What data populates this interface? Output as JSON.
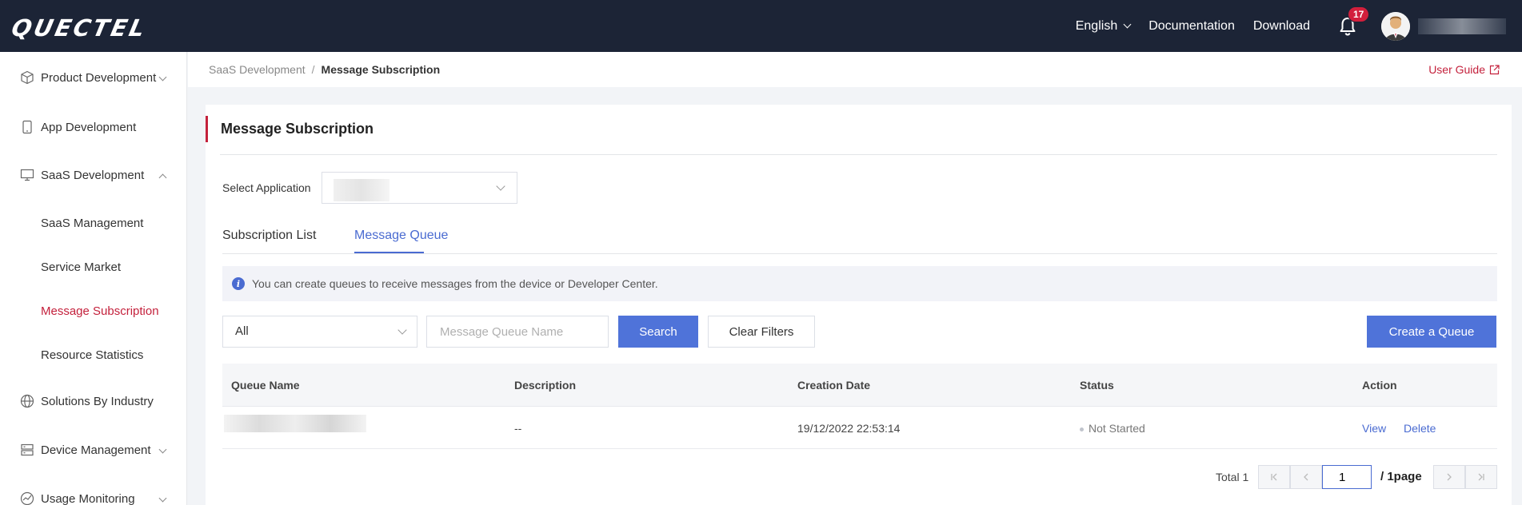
{
  "header": {
    "logo": "QUECTEL",
    "language": "English",
    "documentation": "Documentation",
    "download": "Download",
    "notification_count": "17"
  },
  "sidebar": {
    "items": [
      {
        "label": "Product Development",
        "icon": "cube-icon",
        "expanded": false
      },
      {
        "label": "App Development",
        "icon": "mobile-icon"
      },
      {
        "label": "SaaS Development",
        "icon": "monitor-icon",
        "expanded": true
      },
      {
        "label": "Solutions By Industry",
        "icon": "globe-icon",
        "expanded": false
      },
      {
        "label": "Device Management",
        "icon": "server-icon",
        "expanded": false
      },
      {
        "label": "Usage Monitoring",
        "icon": "gauge-icon",
        "expanded": false
      }
    ],
    "saas_sub": [
      {
        "label": "SaaS Management"
      },
      {
        "label": "Service Market"
      },
      {
        "label": "Message Subscription",
        "active": true
      },
      {
        "label": "Resource Statistics"
      }
    ]
  },
  "breadcrumb": {
    "parent": "SaaS Development",
    "separator": "/",
    "current": "Message Subscription"
  },
  "user_guide": "User Guide",
  "page": {
    "title": "Message Subscription",
    "select_application_label": "Select Application",
    "tabs": [
      {
        "label": "Subscription List",
        "active": false
      },
      {
        "label": "Message Queue",
        "active": true
      }
    ],
    "info_text": "You can create queues to receive messages from the device or Developer Center."
  },
  "filters": {
    "type_value": "All",
    "queue_name_placeholder": "Message Queue Name",
    "search_label": "Search",
    "clear_label": "Clear Filters",
    "create_label": "Create a Queue"
  },
  "table": {
    "columns": [
      "Queue Name",
      "Description",
      "Creation Date",
      "Status",
      "Action"
    ],
    "rows": [
      {
        "description": "--",
        "creation_date": "19/12/2022 22:53:14",
        "status": "Not Started",
        "view": "View",
        "delete": "Delete"
      }
    ]
  },
  "pagination": {
    "total_label": "Total 1",
    "current_page": "1",
    "pages_label": "/ 1page"
  },
  "colors": {
    "topbar": "#1c2436",
    "accent_red": "#c4213c",
    "primary_blue": "#4f73d9"
  }
}
